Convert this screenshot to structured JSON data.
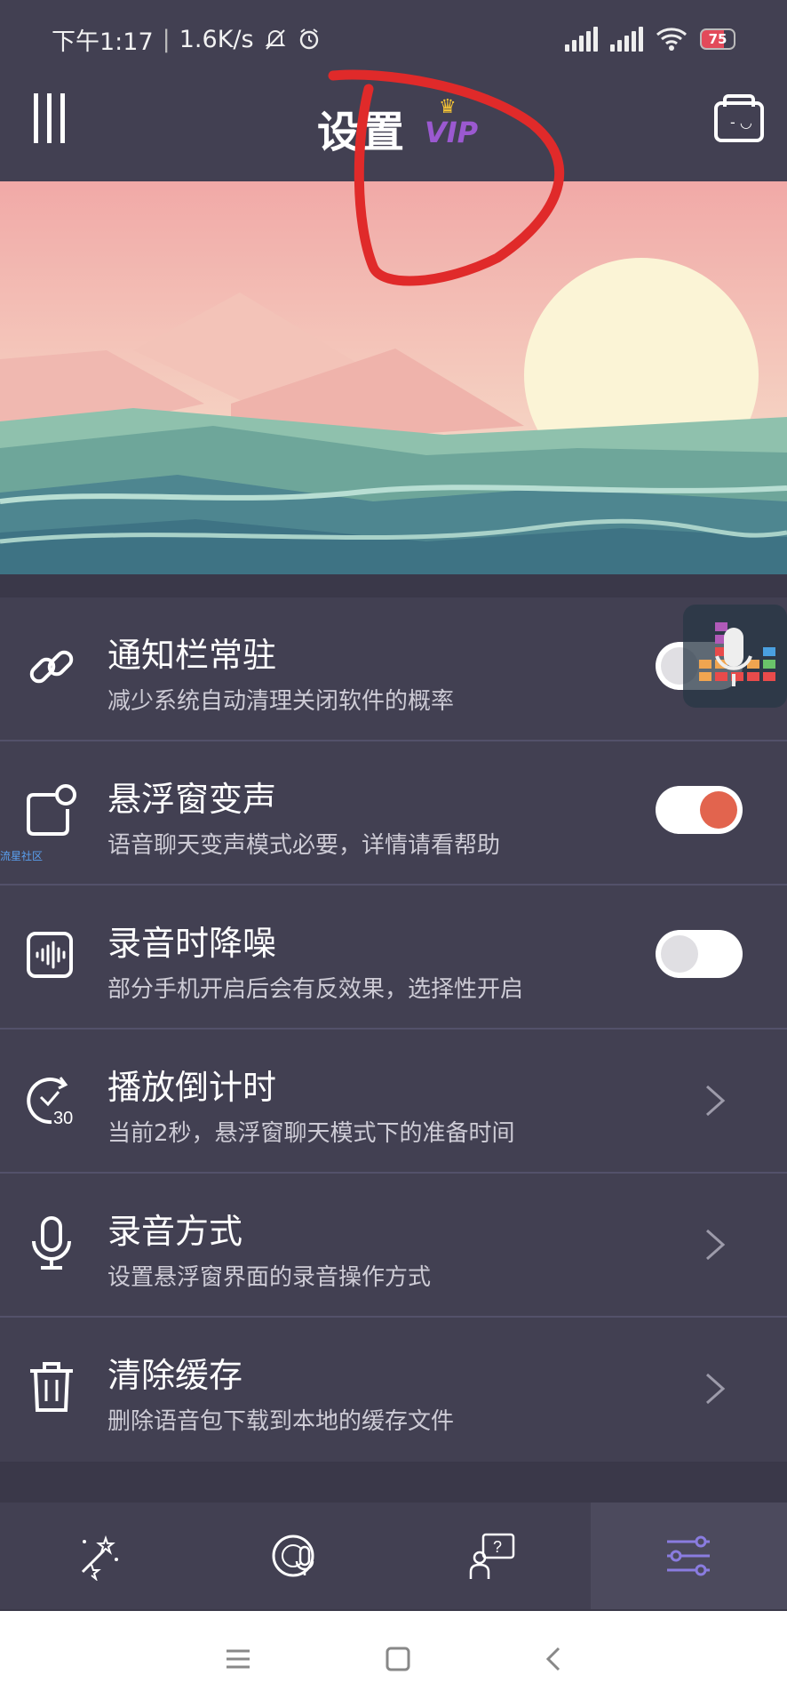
{
  "status_bar": {
    "time": "下午1:17",
    "separator": "|",
    "network_speed": "1.6K/s",
    "battery_level": "75",
    "icons": [
      "bell-off-icon",
      "alarm-icon",
      "signal-icon",
      "signal-icon",
      "wifi-icon",
      "battery-icon"
    ]
  },
  "app_bar": {
    "title": "设置",
    "vip_label": "VIP",
    "menu_icon": "menu-bars-icon",
    "folder_icon": "folder-face-icon"
  },
  "watermark": "流星社区",
  "settings": [
    {
      "title": "通知栏常驻",
      "subtitle": "减少系统自动清理关闭软件的概率",
      "control": "toggle",
      "state": "off",
      "icon": "link-icon"
    },
    {
      "title": "悬浮窗变声",
      "subtitle": "语音聊天变声模式必要，详情请看帮助",
      "control": "toggle",
      "state": "on",
      "icon": "floating-window-icon"
    },
    {
      "title": "录音时降噪",
      "subtitle": "部分手机开启后会有反效果，选择性开启",
      "control": "toggle",
      "state": "off",
      "icon": "waveform-icon"
    },
    {
      "title": "播放倒计时",
      "subtitle": "当前2秒，悬浮窗聊天模式下的准备时间",
      "control": "chevron",
      "icon": "timer-30-icon"
    },
    {
      "title": "录音方式",
      "subtitle": "设置悬浮窗界面的录音操作方式",
      "control": "chevron",
      "icon": "microphone-icon"
    },
    {
      "title": "清除缓存",
      "subtitle": "删除语音包下载到本地的缓存文件",
      "control": "chevron",
      "icon": "trash-icon"
    }
  ],
  "bottom_nav": [
    {
      "icon": "magic-wand-icon",
      "active": false
    },
    {
      "icon": "voice-disc-icon",
      "active": false
    },
    {
      "icon": "help-person-icon",
      "active": false
    },
    {
      "icon": "sliders-icon",
      "active": true
    }
  ],
  "colors": {
    "background": "#3a3849",
    "panel": "#424052",
    "accent_on": "#e2644e",
    "vip": "#9b59d0",
    "active_nav": "#8a7ce0"
  }
}
